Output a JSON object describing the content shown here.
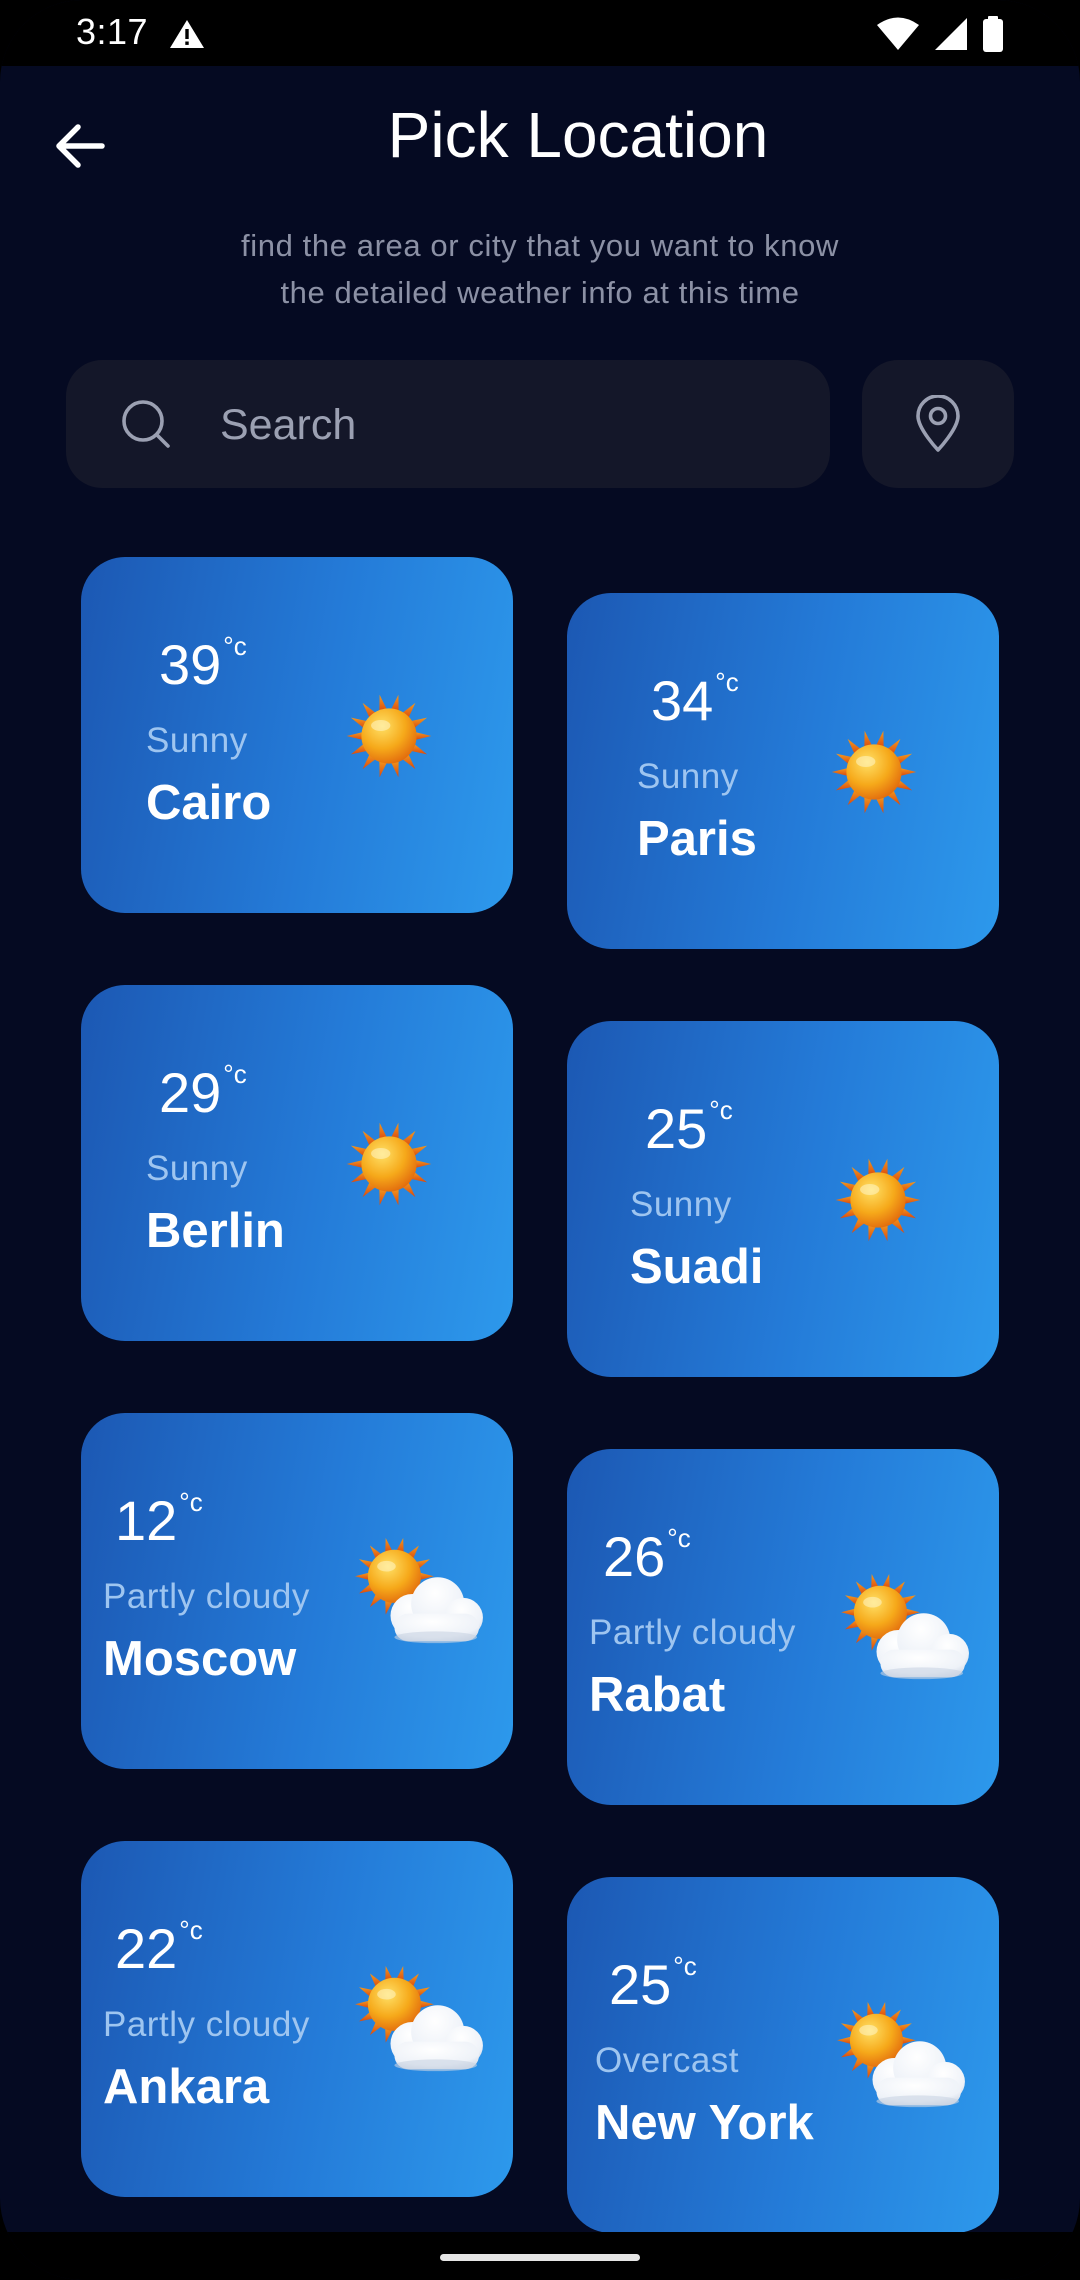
{
  "status_bar": {
    "time": "3:17",
    "icons": [
      "alert-icon",
      "wifi-icon",
      "signal-icon",
      "battery-icon"
    ]
  },
  "header": {
    "title": "Pick Location",
    "subtitle_line1": "find the area or city that you want to know",
    "subtitle_line2": "the detailed weather info at this time"
  },
  "search": {
    "placeholder": "Search",
    "value": ""
  },
  "unit_label": "°c",
  "colors": {
    "background": "#050a22",
    "search_bg": "#141729",
    "card_gradient_start": "#1c58b3",
    "card_gradient_end": "#2d99ec",
    "condition_text": "#9ec5f0"
  },
  "cards": [
    {
      "temp": "39",
      "condition": "Sunny",
      "city": "Cairo",
      "icon": "sun-icon"
    },
    {
      "temp": "34",
      "condition": "Sunny",
      "city": "Paris",
      "icon": "sun-icon"
    },
    {
      "temp": "29",
      "condition": "Sunny",
      "city": "Berlin",
      "icon": "sun-icon"
    },
    {
      "temp": "25",
      "condition": "Sunny",
      "city": "Suadi",
      "icon": "sun-icon"
    },
    {
      "temp": "12",
      "condition": "Partly cloudy",
      "city": "Moscow",
      "icon": "partly-cloudy-icon"
    },
    {
      "temp": "26",
      "condition": "Partly cloudy",
      "city": "Rabat",
      "icon": "partly-cloudy-icon"
    },
    {
      "temp": "22",
      "condition": "Partly cloudy",
      "city": "Ankara",
      "icon": "partly-cloudy-icon"
    },
    {
      "temp": "25",
      "condition": "Overcast",
      "city": "New York",
      "icon": "partly-cloudy-icon"
    }
  ]
}
